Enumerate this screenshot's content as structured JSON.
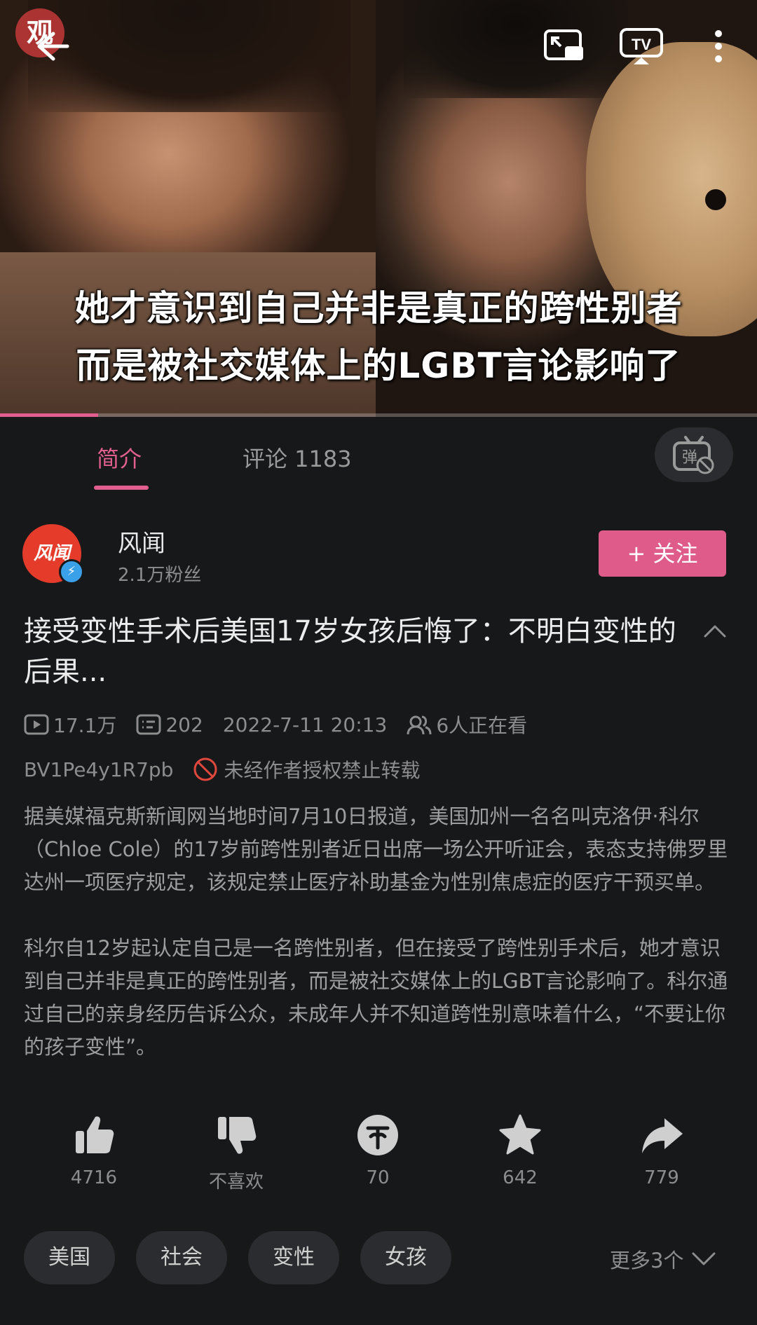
{
  "video": {
    "watermark": "观",
    "subtitle_line1": "她才意识到自己并非是真正的跨性别者",
    "subtitle_line2": "而是被社交媒体上的LGBT言论影响了",
    "progress_percent": 13,
    "buttons": {
      "back_icon": "arrow-left-icon",
      "pip_icon": "picture-in-picture-icon",
      "cast_icon": "tv-cast-icon",
      "more_icon": "more-vertical-icon"
    }
  },
  "tabs": {
    "intro": "简介",
    "comments": "评论 1183",
    "danmaku_icon": "danmaku-off-icon"
  },
  "uploader": {
    "avatar_text": "风闻",
    "name": "风闻",
    "fans": "2.1万粉丝",
    "follow_label": "+ 关注"
  },
  "title": "接受变性手术后美国17岁女孩后悔了：不明白变性的后果...",
  "stats": {
    "views": "17.1万",
    "danmaku": "202",
    "date": "2022-7-11 20:13",
    "watching": "6人正在看",
    "bvid": "BV1Pe4y1R7pb",
    "repost_notice": "未经作者授权禁止转载"
  },
  "description": {
    "p1": "据美媒福克斯新闻网当地时间7月10日报道，美国加州一名名叫克洛伊·科尔（Chloe Cole）的17岁前跨性别者近日出席一场公开听证会，表态支持佛罗里达州一项医疗规定，该规定禁止医疗补助基金为性别焦虑症的医疗干预买单。",
    "p2": "科尔自12岁起认定自己是一名跨性别者，但在接受了跨性别手术后，她才意识到自己并非是真正的跨性别者，而是被社交媒体上的LGBT言论影响了。科尔通过自己的亲身经历告诉公众，未成年人并不知道跨性别意味着什么，“不要让你的孩子变性”。"
  },
  "actions": {
    "like": "4716",
    "dislike": "不喜欢",
    "coin": "70",
    "favorite": "642",
    "share": "779"
  },
  "tags": [
    "美国",
    "社会",
    "变性",
    "女孩"
  ],
  "more_tags": "更多3个",
  "colors": {
    "accent": "#df5b8a",
    "background": "#17181a",
    "chip": "#2b2c2f"
  }
}
